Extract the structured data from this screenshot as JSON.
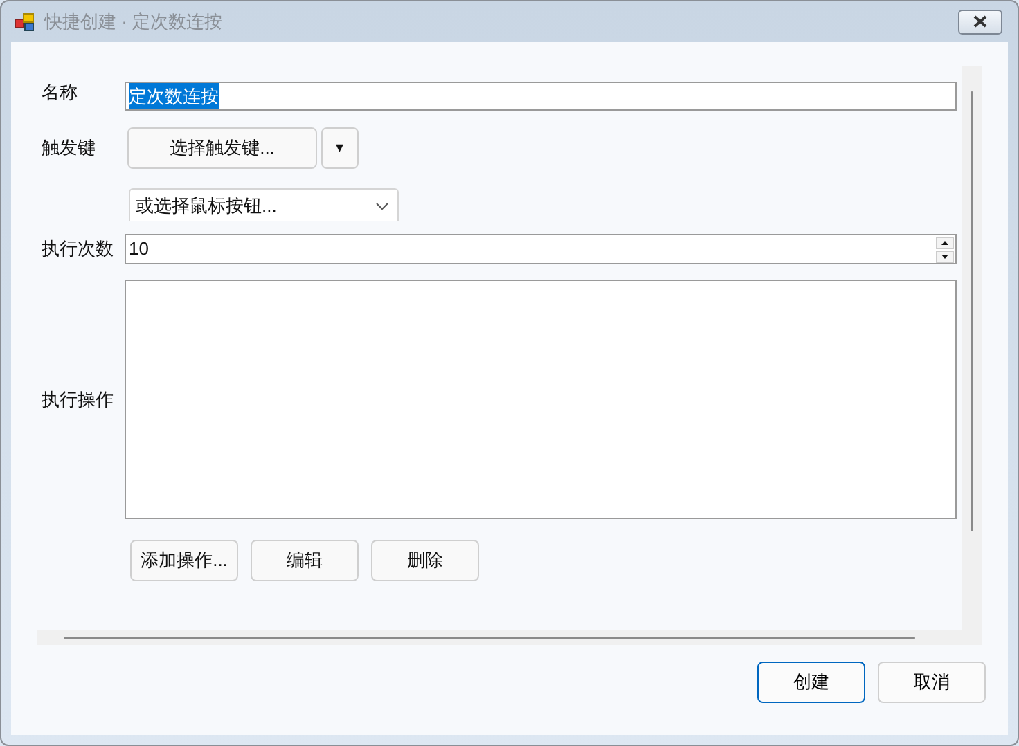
{
  "window": {
    "title": "快捷创建 · 定次数连按"
  },
  "form": {
    "name_label": "名称",
    "name_value": "定次数连按",
    "name_text_selected": true,
    "trigger_label": "触发键",
    "trigger_button": "选择触发键...",
    "trigger_menu_glyph": "▾",
    "mouse_dropdown": "或选择鼠标按钮...",
    "count_label": "执行次数",
    "count_value": "10",
    "actions_label": "执行操作",
    "action_buttons": [
      "添加操作...",
      "编辑",
      "删除"
    ]
  },
  "buttons": [
    {
      "label": "创建",
      "default": true
    },
    {
      "label": "取消",
      "default": false
    }
  ]
}
